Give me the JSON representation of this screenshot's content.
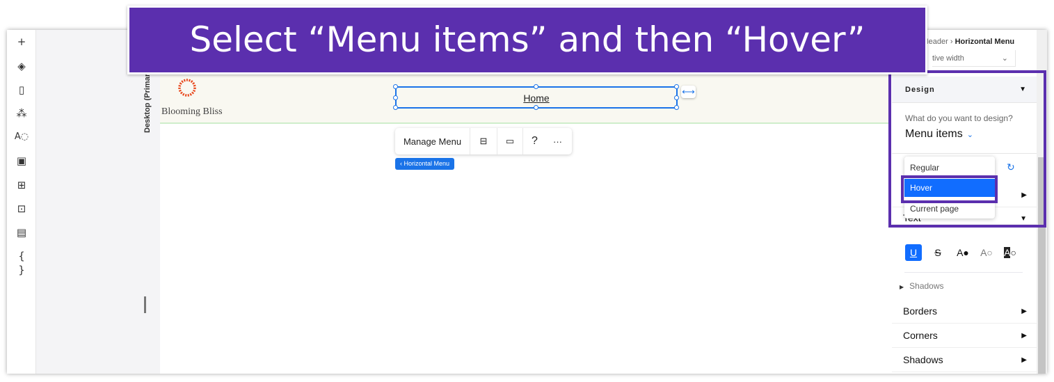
{
  "banner": {
    "text": "Select “Menu items” and then “Hover”"
  },
  "left_toolbar": {
    "icons": [
      "plus-icon",
      "layers-icon",
      "pages-icon",
      "apps-icon",
      "text-theme-icon",
      "media-icon",
      "widgets-icon",
      "business-apps-icon",
      "cms-table-icon",
      "code-icon"
    ]
  },
  "canvas": {
    "viewport_label": "Desktop (Primary)",
    "brand": "Blooming Bliss",
    "menu_item": "Home",
    "toolbar": {
      "manage_menu": "Manage Menu",
      "help": "?",
      "more": "···"
    },
    "breadcrumb_tag": "‹ Horizontal Menu"
  },
  "panel": {
    "breadcrumb": {
      "parent": "Header",
      "current": "Horizontal Menu"
    },
    "width_select": "tive width",
    "design_title": "Design",
    "question": "What do you want to design?",
    "design_target": "Menu items",
    "state_options": [
      "Regular",
      "Hover",
      "Current page"
    ],
    "selected_state": "Hover",
    "text_section": "Text",
    "sub_shadows": "Shadows",
    "sections": [
      "Borders",
      "Corners",
      "Shadows"
    ]
  },
  "colors": {
    "accent": "#116dff",
    "banner": "#5b2fae",
    "brand_logo": "#e8471c"
  }
}
